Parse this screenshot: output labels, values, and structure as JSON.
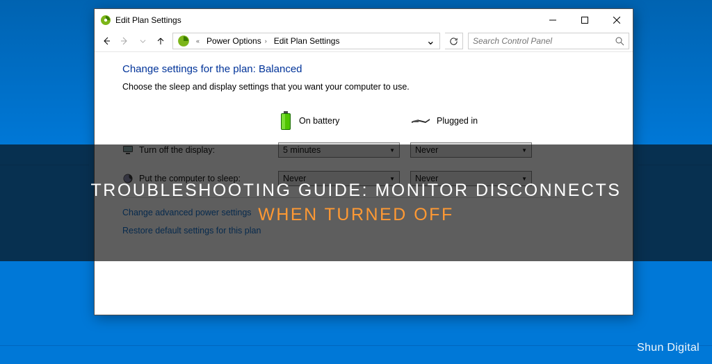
{
  "titlebar": {
    "title": "Edit Plan Settings"
  },
  "breadcrumb": {
    "parent": "Power Options",
    "current": "Edit Plan Settings"
  },
  "search": {
    "placeholder": "Search Control Panel"
  },
  "page": {
    "heading": "Change settings for the plan: Balanced",
    "sub": "Choose the sleep and display settings that you want your computer to use."
  },
  "columns": {
    "battery": "On battery",
    "plugged": "Plugged in"
  },
  "rows": {
    "display": {
      "label": "Turn off the display:",
      "battery": "5 minutes",
      "plugged": "Never"
    },
    "sleep": {
      "label": "Put the computer to sleep:",
      "battery": "Never",
      "plugged": "Never"
    }
  },
  "links": {
    "advanced": "Change advanced power settings",
    "restore": "Restore default settings for this plan"
  },
  "overlay": {
    "line1": "TROUBLESHOOTING GUIDE: MONITOR DISCONNECTS",
    "line2": "WHEN TURNED OFF"
  },
  "watermark": "Shun Digital"
}
